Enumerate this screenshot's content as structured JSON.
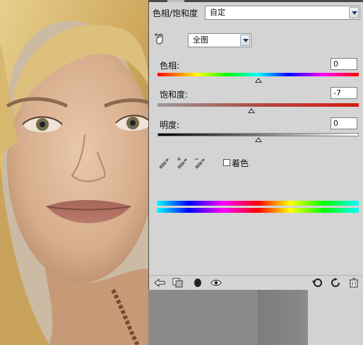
{
  "panel": {
    "preset_title": "色相/饱和度",
    "preset_value": "自定",
    "channel_value": "全图",
    "hue_label": "色相:",
    "hue_value": "0",
    "saturation_label": "饱和度:",
    "saturation_value": "-7",
    "lightness_label": "明度:",
    "lightness_value": "0",
    "colorize_label": "着色"
  },
  "levels": {
    "hue": 0.5,
    "saturation": 0.465,
    "lightness": 0.5
  },
  "icons": {
    "target_adjust": "hand-target-icon",
    "eyedropper": "eyedropper-icon",
    "eyedropper_add": "eyedropper-plus-icon",
    "eyedropper_sub": "eyedropper-minus-icon",
    "back": "back-arrow-icon",
    "clip": "clip-to-layer-icon",
    "mask": "mask-icon",
    "visibility": "eye-icon",
    "previous_state": "previous-state-icon",
    "reset": "reset-icon",
    "delete": "trash-icon"
  },
  "colors": {
    "panel_bg": "#d4d4d4",
    "hue_spectrum": [
      "#ff0000",
      "#ffff00",
      "#00ff00",
      "#00ffff",
      "#0000ff",
      "#ff00ff",
      "#ff0000"
    ]
  }
}
